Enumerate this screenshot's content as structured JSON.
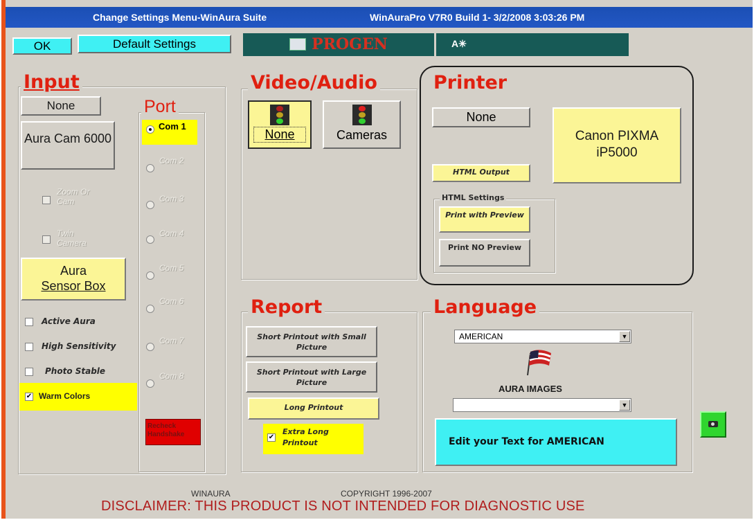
{
  "window": {
    "title": "Change Settings Menu-WinAura Suite",
    "version": "WinAuraPro V7R0 Build 1- 3/2/2008 3:03:26 PM"
  },
  "toolbar": {
    "ok": "OK",
    "default_settings": "Default Settings",
    "logo": "PROGEN",
    "logo2": "A✳"
  },
  "input": {
    "header": "Input",
    "none": "None",
    "aura_cam": "Aura Cam 6000",
    "disabled1": "Zoom Or Cam",
    "disabled2": "Twin Camera",
    "sensor_box_line1": "Aura",
    "sensor_box_line2": "Sensor Box",
    "options": [
      {
        "label": "Active Aura",
        "checked": false
      },
      {
        "label": "High Sensitivity",
        "checked": false
      },
      {
        "label": "Photo Stable",
        "checked": false
      },
      {
        "label": "Warm Colors",
        "checked": true
      }
    ]
  },
  "port": {
    "header": "Port",
    "items": [
      "Com 1",
      "Com 2",
      "Com 3",
      "Com 4",
      "Com 5",
      "Com 6",
      "Com 7",
      "Com 8"
    ],
    "selected_index": 0,
    "recheck": "Recheck Handshake"
  },
  "video": {
    "header": "Video/Audio",
    "none": "None",
    "cameras": "Cameras"
  },
  "printer": {
    "header": "Printer",
    "none": "None",
    "selected": "Canon PIXMA iP5000",
    "html_output": "HTML Output",
    "html_settings": "HTML Settings",
    "print_with_preview": "Print with Preview",
    "print_no_preview": "Print NO Preview"
  },
  "report": {
    "header": "Report",
    "short_small": "Short Printout with Small Picture",
    "short_large": "Short Printout with Large Picture",
    "long": "Long Printout",
    "extra_long": "Extra Long Printout",
    "extra_long_checked": true
  },
  "language": {
    "header": "Language",
    "value": "AMERICAN",
    "aura_images_label": "AURA IMAGES",
    "aura_images_value": "",
    "edit_text": "Edit your Text for AMERICAN"
  },
  "footer": {
    "left": "WINAURA",
    "right": "COPYRIGHT 1996-2007",
    "disclaimer": "DISCLAIMER: THIS PRODUCT IS NOT INTENDED FOR DIAGNOSTIC USE"
  },
  "colors": {
    "header_red": "#e02010",
    "yellow": "#fbf596",
    "cyan": "#3ff0f3",
    "titlebar": "#1f53bc",
    "recheck": "#e00000",
    "camera_green": "#2fd52f"
  }
}
